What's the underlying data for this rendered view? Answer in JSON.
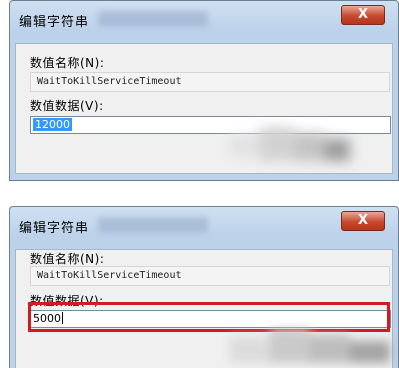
{
  "dialogs": [
    {
      "title": "编辑字符串",
      "close_label": "X",
      "value_name_label": "数值名称(N):",
      "value_name": "WaitToKillServiceTimeout",
      "value_data_label": "数值数据(V):",
      "value_data": "12000"
    },
    {
      "title": "编辑字符串",
      "close_label": "X",
      "value_name_label": "数值名称(N):",
      "value_name": "WaitToKillServiceTimeout",
      "value_data_label": "数值数据(V):",
      "value_data": "5000"
    }
  ],
  "colors": {
    "titlebar": "#bcd2ea",
    "close_button": "#c7492e",
    "highlight_box": "#d11a22",
    "selection": "#3399ff"
  }
}
